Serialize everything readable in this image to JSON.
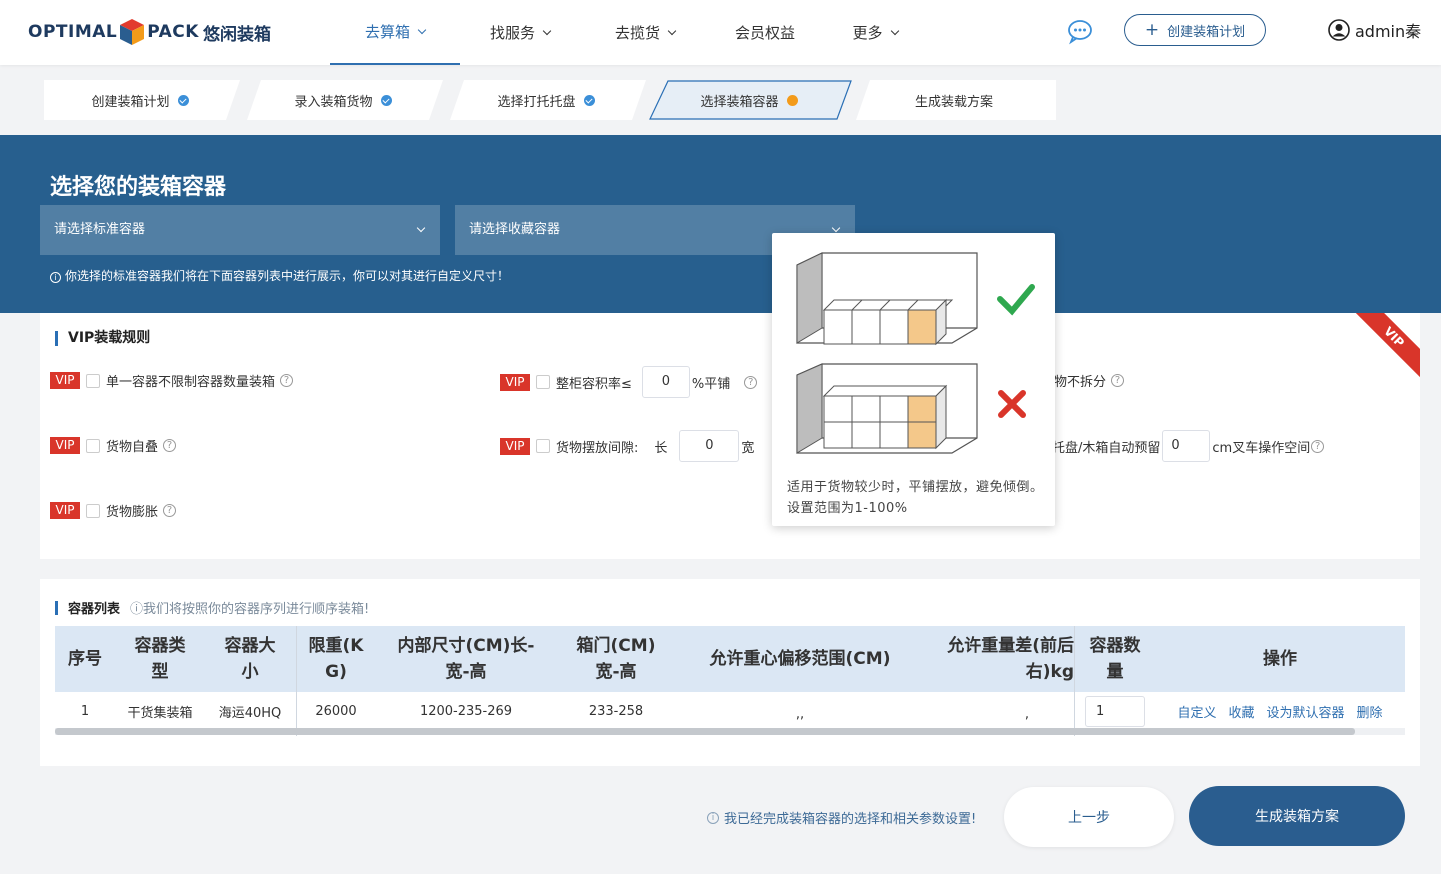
{
  "header": {
    "logo_text_a": "OPTIMAL",
    "logo_text_b": "PACK",
    "logo_cn": "悠闲装箱",
    "nav": [
      {
        "label": "去算箱",
        "active": true,
        "has_dropdown": true
      },
      {
        "label": "找服务",
        "active": false,
        "has_dropdown": true
      },
      {
        "label": "去揽货",
        "active": false,
        "has_dropdown": true
      },
      {
        "label": "会员权益",
        "active": false,
        "has_dropdown": false
      },
      {
        "label": "更多",
        "active": false,
        "has_dropdown": true
      }
    ],
    "create_plan_label": "创建装箱计划",
    "username": "admin秦"
  },
  "steps": [
    {
      "label": "创建装箱计划",
      "status": "done"
    },
    {
      "label": "录入装箱货物",
      "status": "done"
    },
    {
      "label": "选择打托托盘",
      "status": "done"
    },
    {
      "label": "选择装箱容器",
      "status": "current"
    },
    {
      "label": "生成装载方案",
      "status": "pending"
    }
  ],
  "banner": {
    "title": "选择您的装箱容器",
    "standard_select_placeholder": "请选择标准容器",
    "favorite_select_placeholder": "请选择收藏容器",
    "note": "你选择的标准容器我们将在下面容器列表中进行展示，你可以对其进行自定义尺寸！"
  },
  "vip_rules": {
    "title": "VIP装载规则",
    "ribbon": "VIP",
    "vip_tag": "VIP",
    "help_glyph": "?",
    "rule_unlimited": "单一容器不限制容器数量装箱",
    "rule_self_stack": "货物自叠",
    "rule_expand": "货物膨胀",
    "rule_volume_prefix": "整柜容积率≤",
    "rule_volume_value": "0",
    "rule_volume_suffix": "%平铺",
    "rule_gap_prefix": "货物摆放间隙:",
    "rule_gap_length_label": "长",
    "rule_gap_length_value": "0",
    "rule_gap_width_label": "宽",
    "rule_no_split_fragment": "物不拆分",
    "rule_reserve_fragment": "托盘/木箱自动预留",
    "rule_reserve_value": "0",
    "rule_reserve_suffix": "cm叉车操作空间"
  },
  "tooltip": {
    "text": "适用于货物较少时，平铺摆放，避免倾倒。设置范围为1-100%",
    "ok_color": "#2fa84f",
    "bad_color": "#d9352a",
    "box_color": "#f4c88a"
  },
  "container_list": {
    "title": "容器列表",
    "subtitle": "我们将按照你的容器序列进行顺序装箱!",
    "columns": [
      "序号",
      "容器类型",
      "容器大小",
      "限重(KG)",
      "内部尺寸(CM)长-宽-高",
      "箱门(CM)宽-高",
      "允许重心偏移范围(CM)",
      "允许重量差(前后左右)kg",
      "容器数量",
      "操作"
    ],
    "column_lines": [
      [
        "序号"
      ],
      [
        "容器类",
        "型"
      ],
      [
        "容器大",
        "小"
      ],
      [
        "限重(K",
        "G)"
      ],
      [
        "内部尺寸(CM)长-",
        "宽-高"
      ],
      [
        "箱门(CM)",
        "宽-高"
      ],
      [
        "允许重心偏移范围(CM)"
      ],
      [
        "允许重量差(前后",
        "右)kg"
      ],
      [
        "容器数",
        "量"
      ],
      [
        "操作"
      ]
    ],
    "rows": [
      {
        "index": "1",
        "type": "干货集装箱",
        "size": "海运40HQ",
        "max_weight": "26000",
        "inner_dims": "1200-235-269",
        "door": "233-258",
        "cg_offset": ",,",
        "weight_diff": ",",
        "quantity": "1",
        "ops": [
          "自定义",
          "收藏",
          "设为默认容器",
          "删除"
        ]
      }
    ]
  },
  "footer": {
    "note": "我已经完成装箱容器的选择和相关参数设置!",
    "prev_label": "上一步",
    "generate_label": "生成装箱方案"
  },
  "colors": {
    "brand_blue": "#275f8e",
    "link_blue": "#2f6fb0",
    "vip_red": "#d9352a",
    "step_current": "#f39b1a",
    "step_done": "#3b8fd8"
  }
}
